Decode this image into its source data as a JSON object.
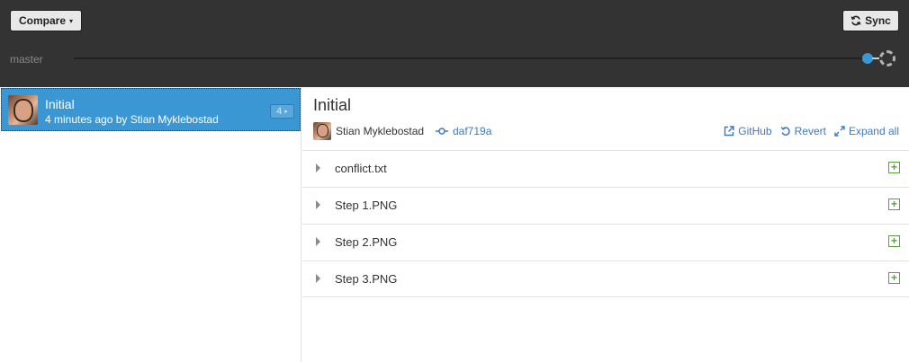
{
  "toolbar": {
    "compare_label": "Compare",
    "compare_caret": "▾",
    "sync_label": "Sync"
  },
  "branch": {
    "name": "master"
  },
  "commits": [
    {
      "title": "Initial",
      "subtitle": "4 minutes ago by Stian Myklebostad",
      "file_count": "4",
      "selected": true
    }
  ],
  "detail": {
    "title": "Initial",
    "author": "Stian Myklebostad",
    "sha": "daf719a",
    "actions": {
      "github": "GitHub",
      "revert": "Revert",
      "expand_all": "Expand all"
    },
    "files": [
      {
        "name": "conflict.txt",
        "status": "added"
      },
      {
        "name": "Step 1.PNG",
        "status": "added"
      },
      {
        "name": "Step 2.PNG",
        "status": "added"
      },
      {
        "name": "Step 3.PNG",
        "status": "added"
      }
    ]
  },
  "colors": {
    "toolbar_bg": "#333333",
    "accent": "#3b97d3",
    "link": "#4078c0",
    "added": "#55a532"
  }
}
